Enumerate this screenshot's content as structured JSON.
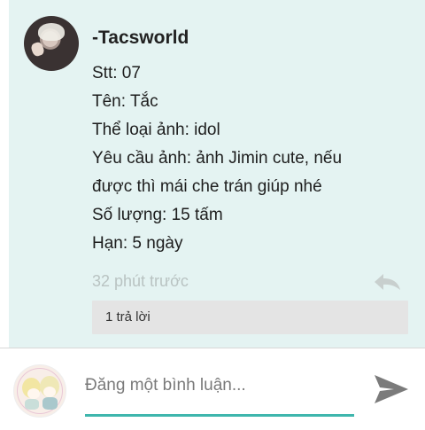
{
  "comment": {
    "author": "-Tacsworld",
    "lines": [
      "Stt: 07",
      "Tên: Tắc",
      "Thể loại ảnh: idol",
      "Yêu cầu ảnh: ảnh Jimin cute, nếu",
      "được thì mái che trán giúp nhé",
      "Số lượng: 15 tấm",
      "Hạn: 5 ngày"
    ],
    "time": "32 phút trước",
    "reply_count": "1 trả lời"
  },
  "compose": {
    "placeholder": "Đăng một bình luận..."
  },
  "colors": {
    "card_background": "#e4f3f2",
    "accent": "#3fb6ad",
    "reply_box": "#e4e4e4"
  },
  "icons": [
    "avatar",
    "reply-icon",
    "send-icon"
  ]
}
